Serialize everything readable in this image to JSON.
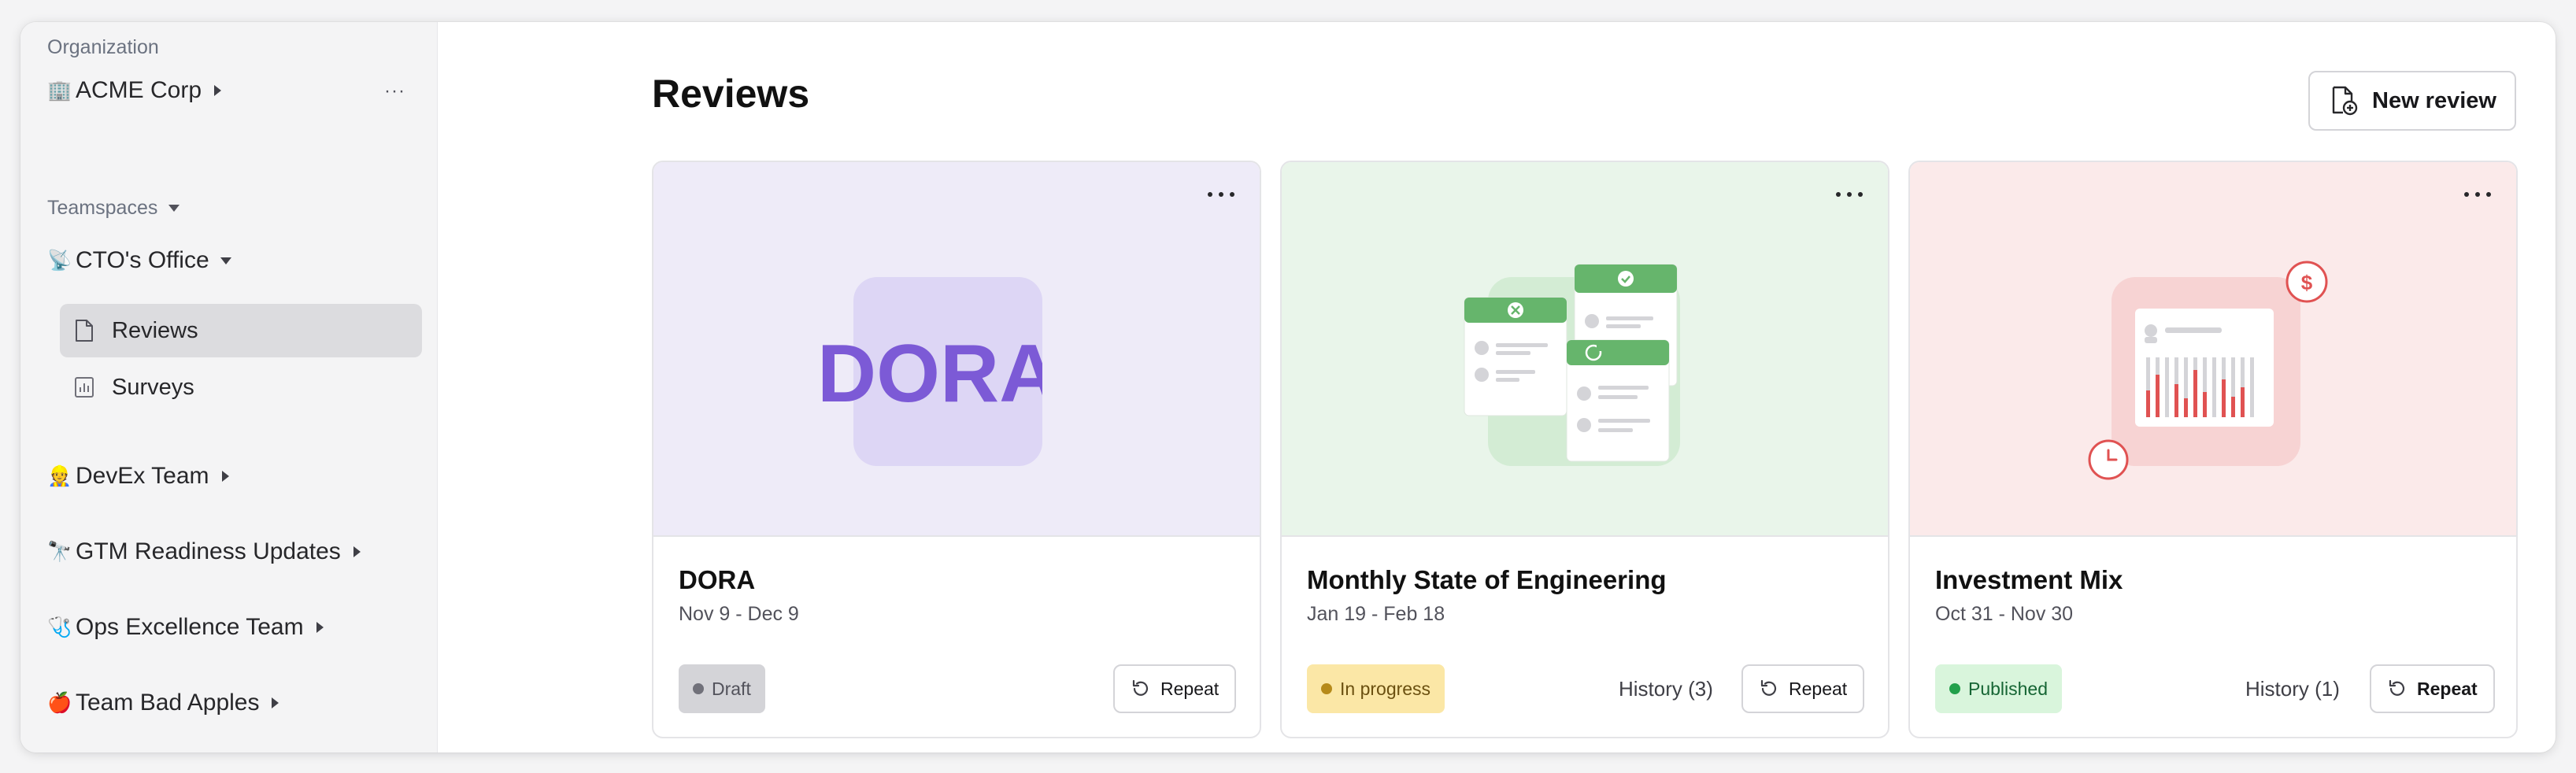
{
  "sidebar": {
    "org_section_label": "Organization",
    "org_name": "ACME Corp",
    "org_emoji": "🏢",
    "org_more": "···",
    "teamspaces_label": "Teamspaces",
    "teamspace": {
      "emoji": "📡",
      "name": "CTO's Office"
    },
    "nav_items": [
      {
        "label": "Reviews",
        "icon": "document-icon",
        "active": true
      },
      {
        "label": "Surveys",
        "icon": "chart-icon",
        "active": false
      }
    ],
    "teams": [
      {
        "emoji": "👷",
        "name": "DevEx Team"
      },
      {
        "emoji": "🔭",
        "name": "GTM Readiness Updates"
      },
      {
        "emoji": "🩺",
        "name": "Ops Excellence Team"
      },
      {
        "emoji": "🍎",
        "name": "Team Bad Apples"
      }
    ]
  },
  "main": {
    "title": "Reviews",
    "new_review_label": "New review",
    "cards": [
      {
        "title": "DORA",
        "dates": "Nov 9 - Dec 9",
        "status": "Draft",
        "history": "",
        "repeat": "Repeat",
        "hero_text": "DORA",
        "hero_bg": "#eeebf8",
        "status_bg": "#d4d4d8",
        "status_fg": "#52525b",
        "status_dot": "#71717a"
      },
      {
        "title": "Monthly State of Engineering",
        "dates": "Jan 19 - Feb 18",
        "status": "In progress",
        "history": "History (3)",
        "repeat": "Repeat",
        "hero_bg": "#e9f5ea",
        "status_bg": "#fbe7a6",
        "status_fg": "#6b5010",
        "status_dot": "#b68a1a"
      },
      {
        "title": "Investment Mix",
        "dates": "Oct 31 - Nov 30",
        "status": "Published",
        "history": "History (1)",
        "repeat": "Repeat",
        "hero_bg": "#fbeaea",
        "status_bg": "#d9f5dc",
        "status_fg": "#166534",
        "status_dot": "#22a04b"
      }
    ]
  },
  "colors": {
    "accent_purple": "#7c5ad6",
    "accent_green": "#66b56c",
    "accent_red": "#e05252"
  }
}
